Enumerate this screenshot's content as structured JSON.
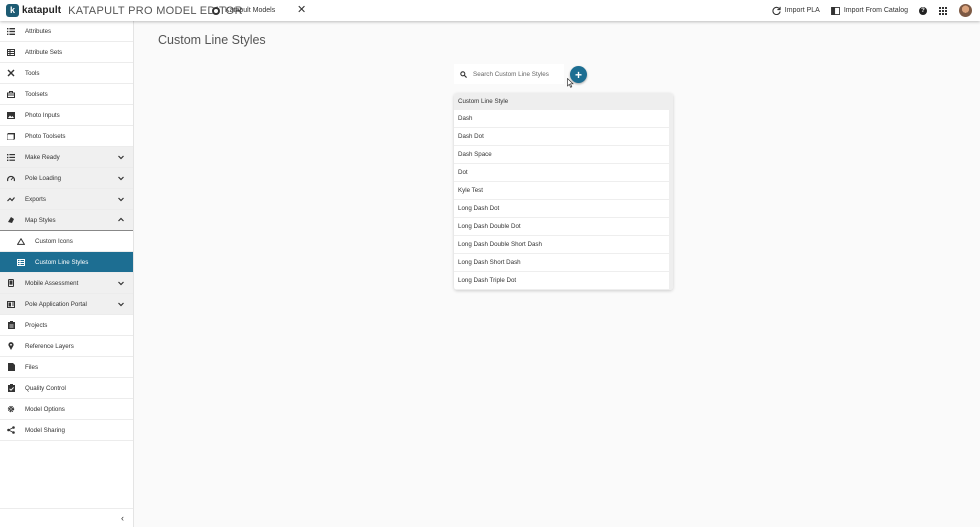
{
  "header": {
    "logo_text": "katapult",
    "app_title": "KATAPULT PRO MODEL EDITOR",
    "tab_label": "Katapult Models",
    "import_pla_label": "Import PLA",
    "import_catalog_label": "Import From Catalog"
  },
  "sidebar": {
    "items": [
      {
        "label": "Attributes",
        "icon": "list-icon"
      },
      {
        "label": "Attribute Sets",
        "icon": "table-icon"
      },
      {
        "label": "Tools",
        "icon": "tools-icon"
      },
      {
        "label": "Toolsets",
        "icon": "toolbox-icon"
      },
      {
        "label": "Photo Inputs",
        "icon": "photo-icon"
      },
      {
        "label": "Photo Toolsets",
        "icon": "photo-stack-icon"
      },
      {
        "label": "Make Ready",
        "icon": "checklist-icon"
      },
      {
        "label": "Pole Loading",
        "icon": "gauge-icon"
      },
      {
        "label": "Exports",
        "icon": "export-icon"
      },
      {
        "label": "Map Styles",
        "icon": "palette-icon"
      },
      {
        "label": "Custom Icons",
        "icon": "triangle-icon"
      },
      {
        "label": "Custom Line Styles",
        "icon": "line-styles-icon"
      },
      {
        "label": "Mobile Assessment",
        "icon": "mobile-icon"
      },
      {
        "label": "Pole Application Portal",
        "icon": "portal-icon"
      },
      {
        "label": "Projects",
        "icon": "clipboard-icon"
      },
      {
        "label": "Reference Layers",
        "icon": "map-pin-icon"
      },
      {
        "label": "Files",
        "icon": "file-icon"
      },
      {
        "label": "Quality Control",
        "icon": "clipboard-check-icon"
      },
      {
        "label": "Model Options",
        "icon": "gear-icon"
      },
      {
        "label": "Model Sharing",
        "icon": "share-icon"
      }
    ]
  },
  "main": {
    "title": "Custom Line Styles",
    "search_placeholder": "Search Custom Line Styles",
    "table_header": "Custom Line Style",
    "rows": [
      "Dash",
      "Dash Dot",
      "Dash Space",
      "Dot",
      "Kyle Test",
      "Long Dash Dot",
      "Long Dash Double Dot",
      "Long Dash Double Short Dash",
      "Long Dash Short Dash",
      "Long Dash Triple Dot"
    ]
  },
  "colors": {
    "accent": "#1d6e92",
    "brand": "#1d5b73",
    "group_bg": "#f0f0f0"
  }
}
